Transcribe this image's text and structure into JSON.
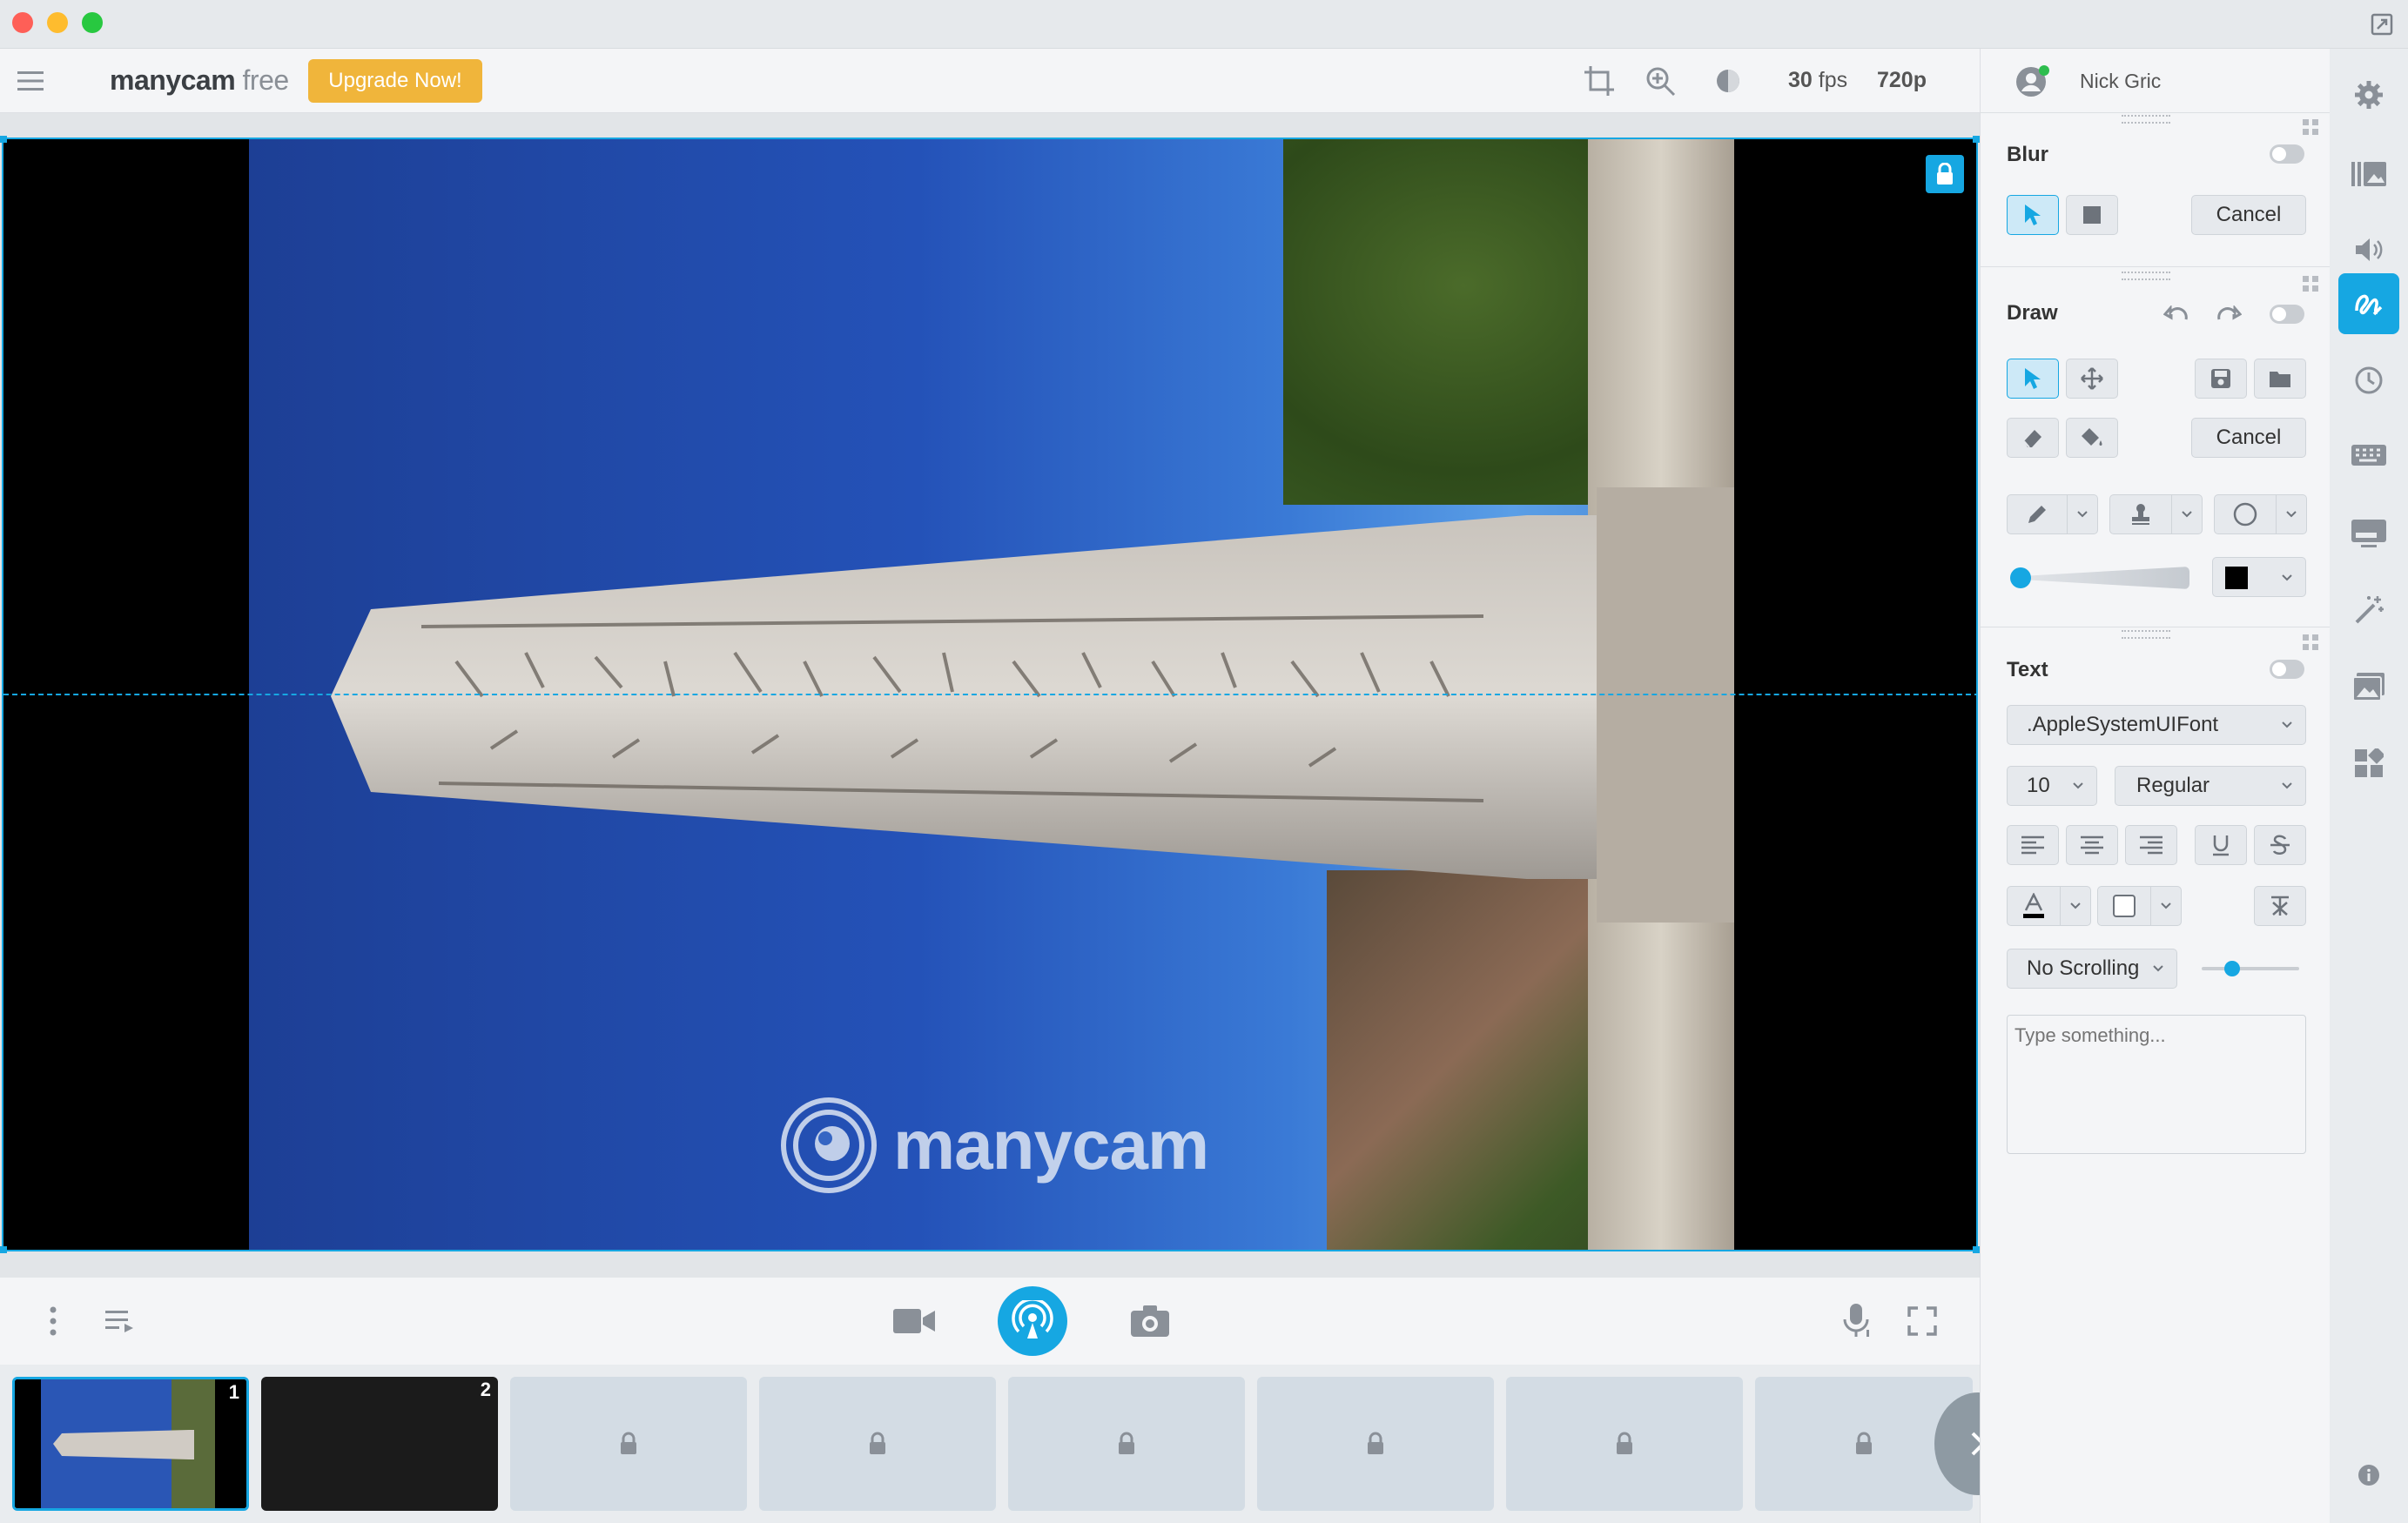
{
  "app": {
    "logo_bold": "manycam",
    "logo_free": "free",
    "upgrade_label": "Upgrade Now!"
  },
  "toolbar": {
    "fps": "30",
    "fps_unit": "fps",
    "resolution": "720p",
    "icons": [
      "crop-icon",
      "zoom-icon",
      "brightness-icon"
    ]
  },
  "user": {
    "name": "Nick Gric",
    "status": "online"
  },
  "watermark": "manycam",
  "colors": {
    "accent": "#16a7e2",
    "upgrade": "#f0b53b",
    "toggle_off": "#c9cdd2"
  },
  "blur": {
    "title": "Blur",
    "cancel_label": "Cancel",
    "enabled": false
  },
  "draw": {
    "title": "Draw",
    "cancel_label": "Cancel",
    "enabled": false,
    "brush_size": 0.0,
    "color": "#000000"
  },
  "text": {
    "title": "Text",
    "enabled": false,
    "font": ".AppleSystemUIFont",
    "size": "10",
    "style": "Regular",
    "scrolling": "No Scrolling",
    "scroll_speed": 0.3,
    "placeholder": "Type something..."
  },
  "presets": [
    {
      "num": "1",
      "locked": false,
      "active": true
    },
    {
      "num": "2",
      "locked": false,
      "active": false
    },
    {
      "num": "",
      "locked": true
    },
    {
      "num": "",
      "locked": true
    },
    {
      "num": "",
      "locked": true
    },
    {
      "num": "",
      "locked": true
    },
    {
      "num": "",
      "locked": true
    },
    {
      "num": "",
      "locked": true
    }
  ],
  "rail": [
    "settings-icon",
    "media-icon",
    "audio-icon",
    "draw-icon",
    "history-icon",
    "keyboard-icon",
    "lower-third-icon",
    "effects-icon",
    "images-icon",
    "widgets-icon",
    "info-icon"
  ]
}
